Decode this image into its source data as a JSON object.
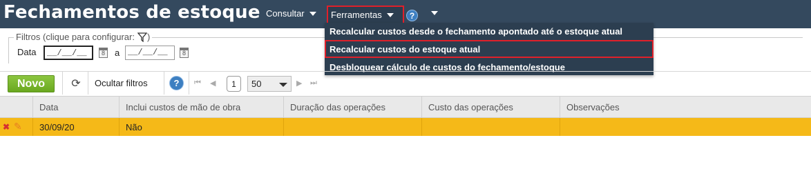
{
  "header": {
    "title": "Fechamentos de estoque",
    "menu_consultar": "Consultar",
    "menu_ferramentas": "Ferramentas",
    "help_icon": "help-icon"
  },
  "dropdown": {
    "items": [
      "Recalcular custos desde o fechamento apontado até o estoque atual",
      "Recalcular custos do estoque atual",
      "Desbloquear cálculo de custos do fechamento/estoque"
    ]
  },
  "filters": {
    "legend": "Filtros (clique para configurar:",
    "legend_close": ")",
    "date_label": "Data",
    "date_from_value": "__/__/__",
    "to_label": "a",
    "date_to_value": "__/__/__"
  },
  "toolbar": {
    "new_label": "Novo",
    "hide_filters_label": "Ocultar filtros",
    "page_number": "1",
    "page_size": "50"
  },
  "table": {
    "columns": [
      "Data",
      "Inclui custos de mão de obra",
      "Duração das operações",
      "Custo das operações",
      "Observações"
    ],
    "rows": [
      {
        "data": "30/09/20",
        "inclui_mao_de_obra": "Não",
        "duracao": "",
        "custo": "",
        "observacoes": ""
      }
    ]
  },
  "colors": {
    "header_bg": "#34495e",
    "highlight_border": "#e0202a",
    "new_button": "#7ab82f",
    "selected_row": "#f5b918"
  }
}
